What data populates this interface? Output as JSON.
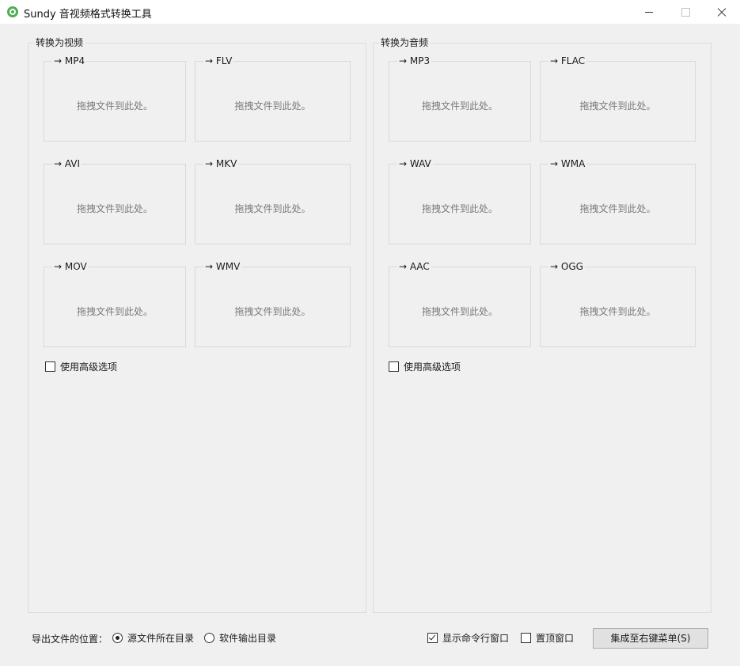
{
  "window": {
    "title": "Sundy 音视频格式转换工具",
    "icon": "app-logo-icon"
  },
  "video_group": {
    "title": "转换为视频",
    "targets": [
      {
        "label": "→ MP4",
        "hint": "拖拽文件到此处。"
      },
      {
        "label": "→ FLV",
        "hint": "拖拽文件到此处。"
      },
      {
        "label": "→ AVI",
        "hint": "拖拽文件到此处。"
      },
      {
        "label": "→ MKV",
        "hint": "拖拽文件到此处。"
      },
      {
        "label": "→ MOV",
        "hint": "拖拽文件到此处。"
      },
      {
        "label": "→ WMV",
        "hint": "拖拽文件到此处。"
      }
    ],
    "advanced_label": "使用高级选项",
    "advanced_checked": false
  },
  "audio_group": {
    "title": "转换为音频",
    "targets": [
      {
        "label": "→ MP3",
        "hint": "拖拽文件到此处。"
      },
      {
        "label": "→ FLAC",
        "hint": "拖拽文件到此处。"
      },
      {
        "label": "→ WAV",
        "hint": "拖拽文件到此处。"
      },
      {
        "label": "→ WMA",
        "hint": "拖拽文件到此处。"
      },
      {
        "label": "→ AAC",
        "hint": "拖拽文件到此处。"
      },
      {
        "label": "→ OGG",
        "hint": "拖拽文件到此处。"
      }
    ],
    "advanced_label": "使用高级选项",
    "advanced_checked": false
  },
  "footer": {
    "output_label": "导出文件的位置：",
    "radio_source_label": "源文件所在目录",
    "radio_source_selected": true,
    "radio_software_label": "软件输出目录",
    "show_cmd_label": "显示命令行窗口",
    "show_cmd_checked": true,
    "pin_top_label": "置顶窗口",
    "pin_top_checked": false,
    "system_button_label": "集成至右键菜单(S)"
  }
}
